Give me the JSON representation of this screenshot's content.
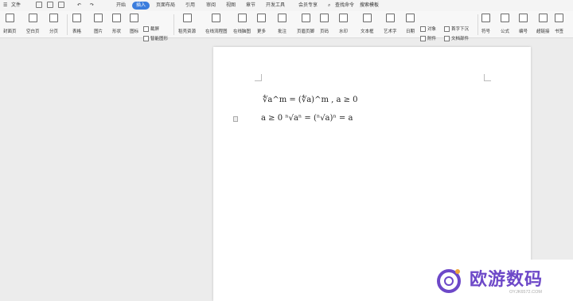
{
  "menubar": {
    "file": "文件",
    "tabs": [
      "开始",
      "插入",
      "页面布局",
      "引用",
      "审阅",
      "视图",
      "章节",
      "开发工具",
      "会员专享"
    ],
    "active_tab": "插入",
    "search": "查找命令",
    "search2": "搜索模板"
  },
  "ribbon": {
    "buttons": [
      "封面页",
      "空白页",
      "分页",
      "表格",
      "图片",
      "形状",
      "图标",
      "稻壳资源",
      "在线流程图",
      "在线脑图",
      "更多",
      "批注",
      "页眉页脚",
      "页码",
      "水印",
      "文本框",
      "艺术字",
      "日期",
      "附件",
      "文档部件",
      "符号",
      "公式",
      "编号",
      "超链接",
      "书签"
    ],
    "small": [
      "截屏",
      "智能图形",
      "对象",
      "首字下沉"
    ]
  },
  "document": {
    "line1": "∜a^m = (∜a)^m , a ≥ 0",
    "line2": "a ≥ 0 ⁿ√aⁿ = (ⁿ√a)ⁿ = a"
  },
  "watermark": {
    "brand": "欧游数码",
    "site": "OYJK6572.COM"
  },
  "colors": {
    "active_tab": "#3b7ddd",
    "brand": "#6d48c8"
  }
}
